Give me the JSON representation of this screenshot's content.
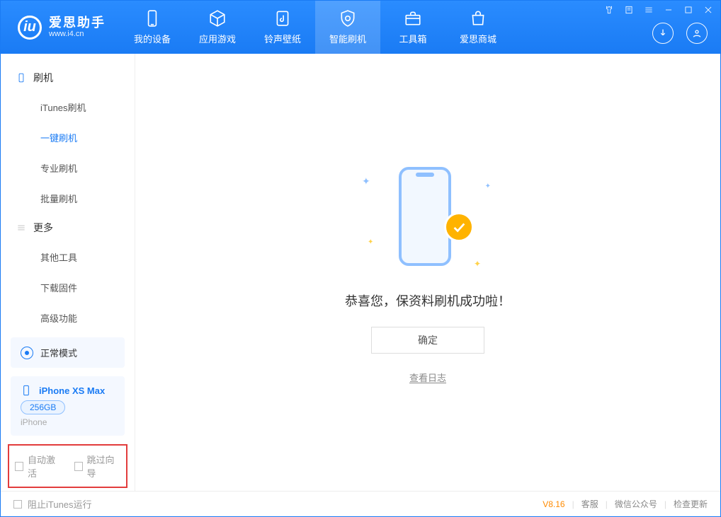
{
  "app": {
    "name_cn": "爱思助手",
    "name_en": "www.i4.cn"
  },
  "tabs": [
    {
      "label": "我的设备"
    },
    {
      "label": "应用游戏"
    },
    {
      "label": "铃声壁纸"
    },
    {
      "label": "智能刷机"
    },
    {
      "label": "工具箱"
    },
    {
      "label": "爱思商城"
    }
  ],
  "sidebar": {
    "section_flash": "刷机",
    "items_flash": [
      "iTunes刷机",
      "一键刷机",
      "专业刷机",
      "批量刷机"
    ],
    "section_more": "更多",
    "items_more": [
      "其他工具",
      "下载固件",
      "高级功能"
    ]
  },
  "mode": {
    "label": "正常模式"
  },
  "device": {
    "name": "iPhone XS Max",
    "capacity": "256GB",
    "type": "iPhone"
  },
  "options": {
    "auto_activate": "自动激活",
    "skip_guide": "跳过向导"
  },
  "result": {
    "message": "恭喜您，保资料刷机成功啦！",
    "ok": "确定",
    "view_log": "查看日志"
  },
  "status": {
    "block_itunes": "阻止iTunes运行",
    "version": "V8.16",
    "links": [
      "客服",
      "微信公众号",
      "检查更新"
    ]
  }
}
